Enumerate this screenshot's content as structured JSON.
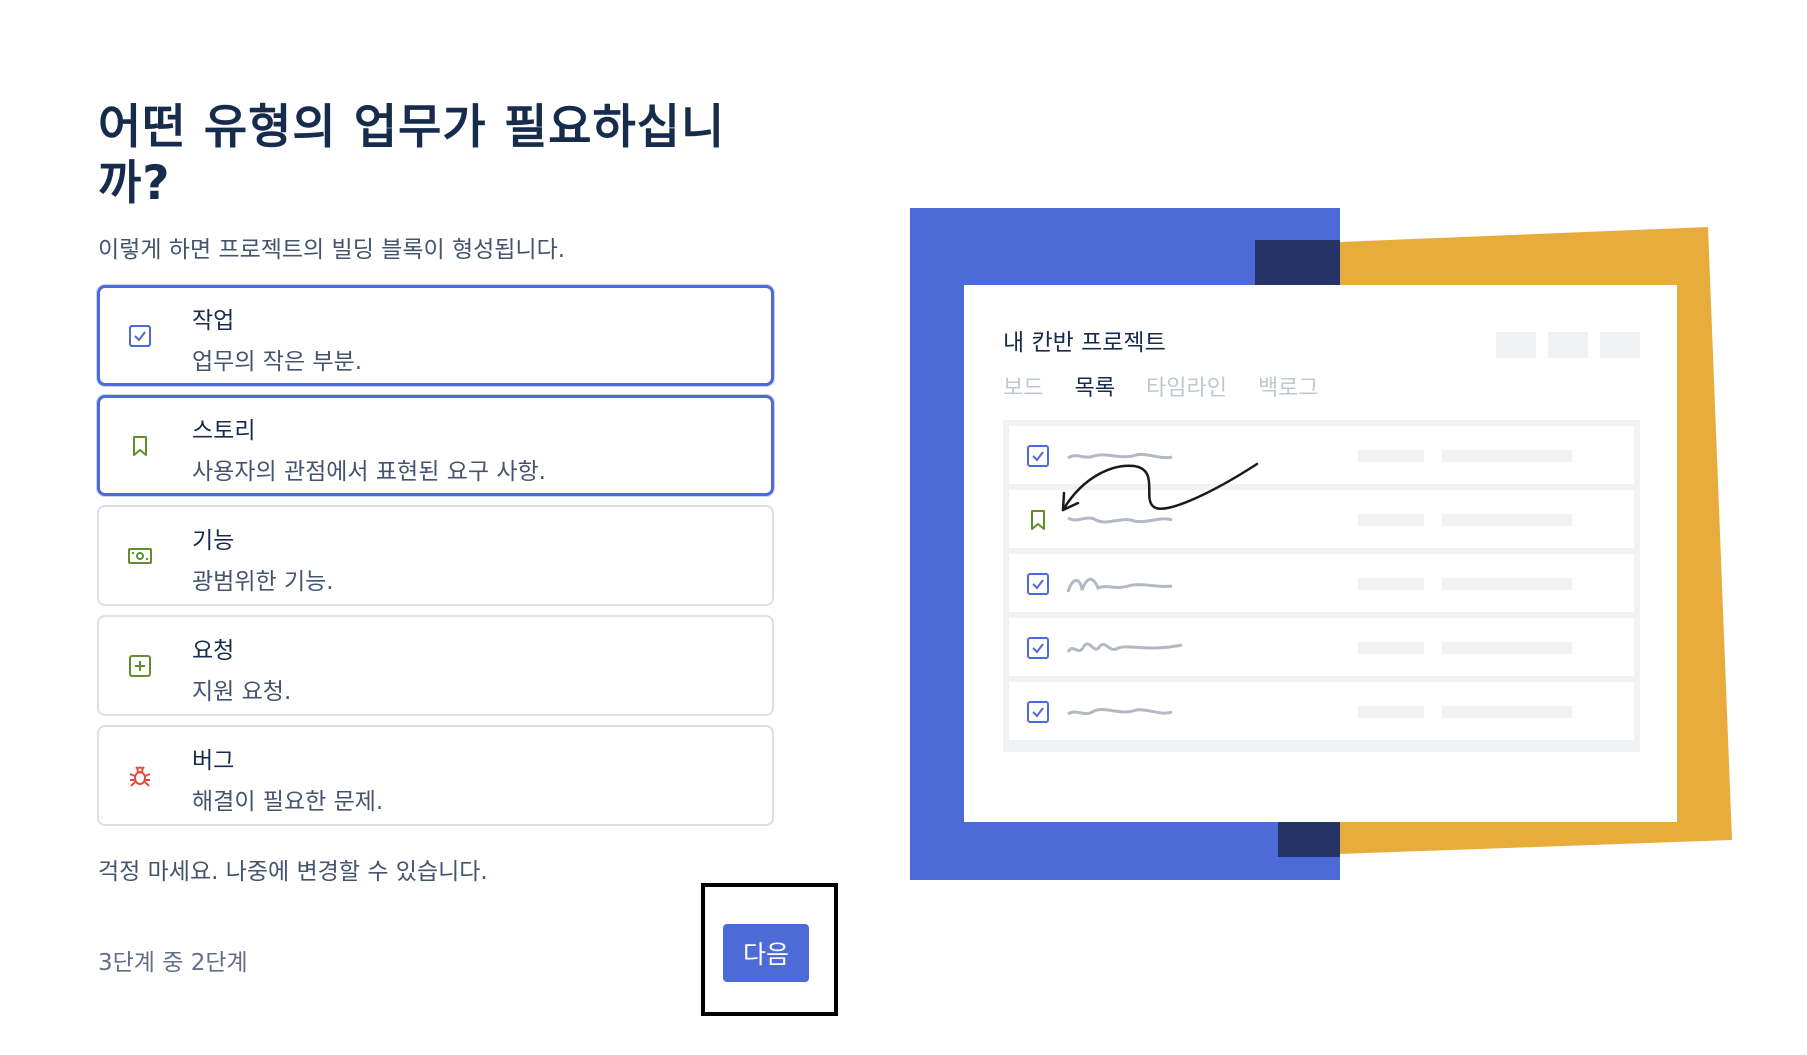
{
  "heading": "어떤 유형의 업무가 필요하십니까?",
  "subtitle": "이렇게 하면 프로젝트의 빌딩 블록이 형성됩니다.",
  "options": [
    {
      "title": "작업",
      "description": "업무의 작은 부분.",
      "icon": "task-checkbox-icon",
      "selected": true
    },
    {
      "title": "스토리",
      "description": "사용자의 관점에서 표현된 요구 사항.",
      "icon": "story-bookmark-icon",
      "selected": true
    },
    {
      "title": "기능",
      "description": "광범위한 기능.",
      "icon": "feature-money-icon",
      "selected": false
    },
    {
      "title": "요청",
      "description": "지원 요청.",
      "icon": "request-plus-icon",
      "selected": false
    },
    {
      "title": "버그",
      "description": "해결이 필요한 문제.",
      "icon": "bug-icon",
      "selected": false
    }
  ],
  "reassurance": "걱정 마세요. 나중에 변경할 수 있습니다.",
  "step_indicator": "3단계 중 2단계",
  "next_label": "다음",
  "illustration": {
    "project_title": "내 칸반 프로젝트",
    "tabs": [
      "보드",
      "목록",
      "타임라인",
      "백로그"
    ],
    "active_tab": "목록",
    "rows": [
      "task-checkbox-icon",
      "story-bookmark-icon",
      "task-checkbox-icon",
      "task-checkbox-icon",
      "task-checkbox-icon"
    ]
  },
  "colors": {
    "accent_blue": "#4c6bd6",
    "dark_navy": "#253366",
    "accent_yellow": "#e8ac3c",
    "task_icon": "#4c6bd6",
    "story_icon": "#5e8f2a",
    "feature_icon": "#5e8f2a",
    "request_icon": "#5e8f2a",
    "bug_icon": "#e04c3c"
  }
}
